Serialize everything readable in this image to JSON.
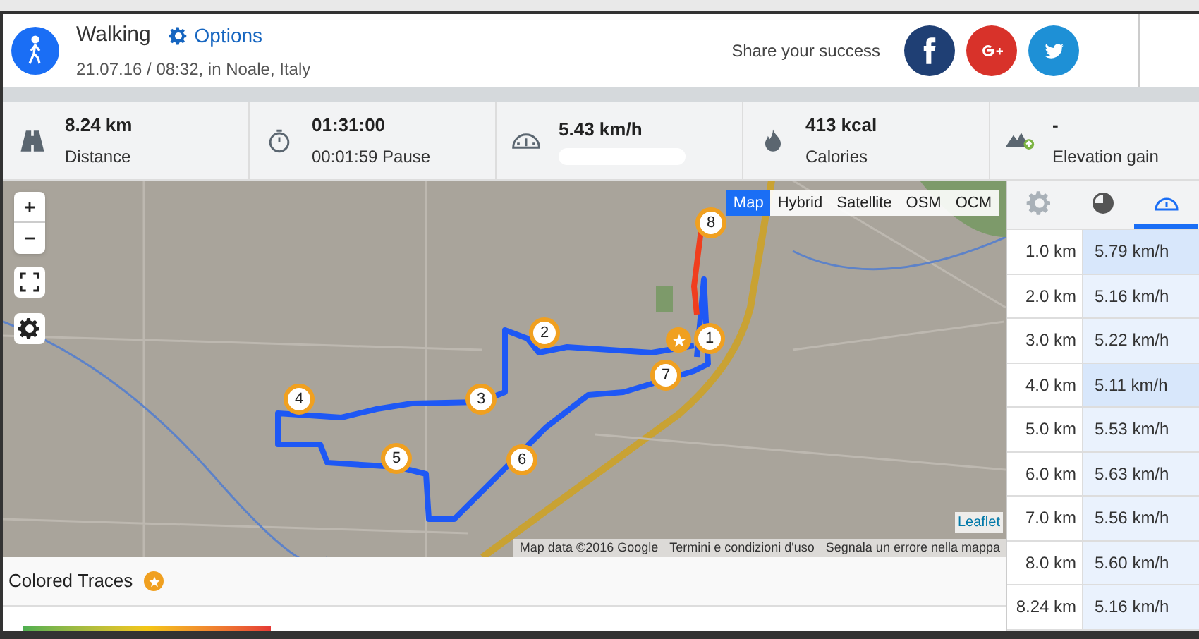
{
  "header": {
    "title": "Walking",
    "options_link": "Options",
    "subtitle": "21.07.16 / 08:32, in Noale, Italy",
    "share_label": "Share your success"
  },
  "stats": [
    {
      "kind": "road",
      "value": "8.24 km",
      "label": "Distance"
    },
    {
      "kind": "timer",
      "value": "01:31:00",
      "label": "00:01:59 Pause"
    },
    {
      "kind": "gauge",
      "value": "5.43 km/h"
    },
    {
      "kind": "flame",
      "value": "413 kcal",
      "label": "Calories"
    },
    {
      "kind": "mountain",
      "value": "-",
      "label": "Elevation gain"
    }
  ],
  "map": {
    "layers": [
      {
        "label": "Map",
        "selected": true
      },
      {
        "label": "Hybrid",
        "selected": false
      },
      {
        "label": "Satellite",
        "selected": false
      },
      {
        "label": "OSM",
        "selected": false
      },
      {
        "label": "OCM",
        "selected": false
      }
    ],
    "markers": [
      {
        "label": "8"
      },
      {
        "label": "2"
      },
      {
        "label": "1"
      },
      {
        "label": "7"
      },
      {
        "label": "4"
      },
      {
        "label": "3"
      },
      {
        "label": "5"
      },
      {
        "label": "6"
      }
    ],
    "attribution": [
      "Map data ©2016 Google",
      "Termini e condizioni d'uso",
      "Segnala un errore nella mappa"
    ],
    "leaflet": "Leaflet"
  },
  "colored_traces": {
    "label": "Colored Traces"
  },
  "splits": {
    "tabs": [
      {
        "kind": "settings",
        "selected": false
      },
      {
        "kind": "pie",
        "selected": false
      },
      {
        "kind": "gauge",
        "selected": true
      }
    ],
    "rows": [
      {
        "distance": "1.0 km",
        "speed": "5.79 km/h",
        "highlighted": true
      },
      {
        "distance": "2.0 km",
        "speed": "5.16 km/h",
        "highlighted": false
      },
      {
        "distance": "3.0 km",
        "speed": "5.22 km/h",
        "highlighted": false
      },
      {
        "distance": "4.0 km",
        "speed": "5.11 km/h",
        "highlighted": true
      },
      {
        "distance": "5.0 km",
        "speed": "5.53 km/h",
        "highlighted": false
      },
      {
        "distance": "6.0 km",
        "speed": "5.63 km/h",
        "highlighted": false
      },
      {
        "distance": "7.0 km",
        "speed": "5.56 km/h",
        "highlighted": false
      },
      {
        "distance": "8.0 km",
        "speed": "5.60 km/h",
        "highlighted": false
      },
      {
        "distance": "8.24 km",
        "speed": "5.16 km/h",
        "highlighted": false
      }
    ]
  }
}
